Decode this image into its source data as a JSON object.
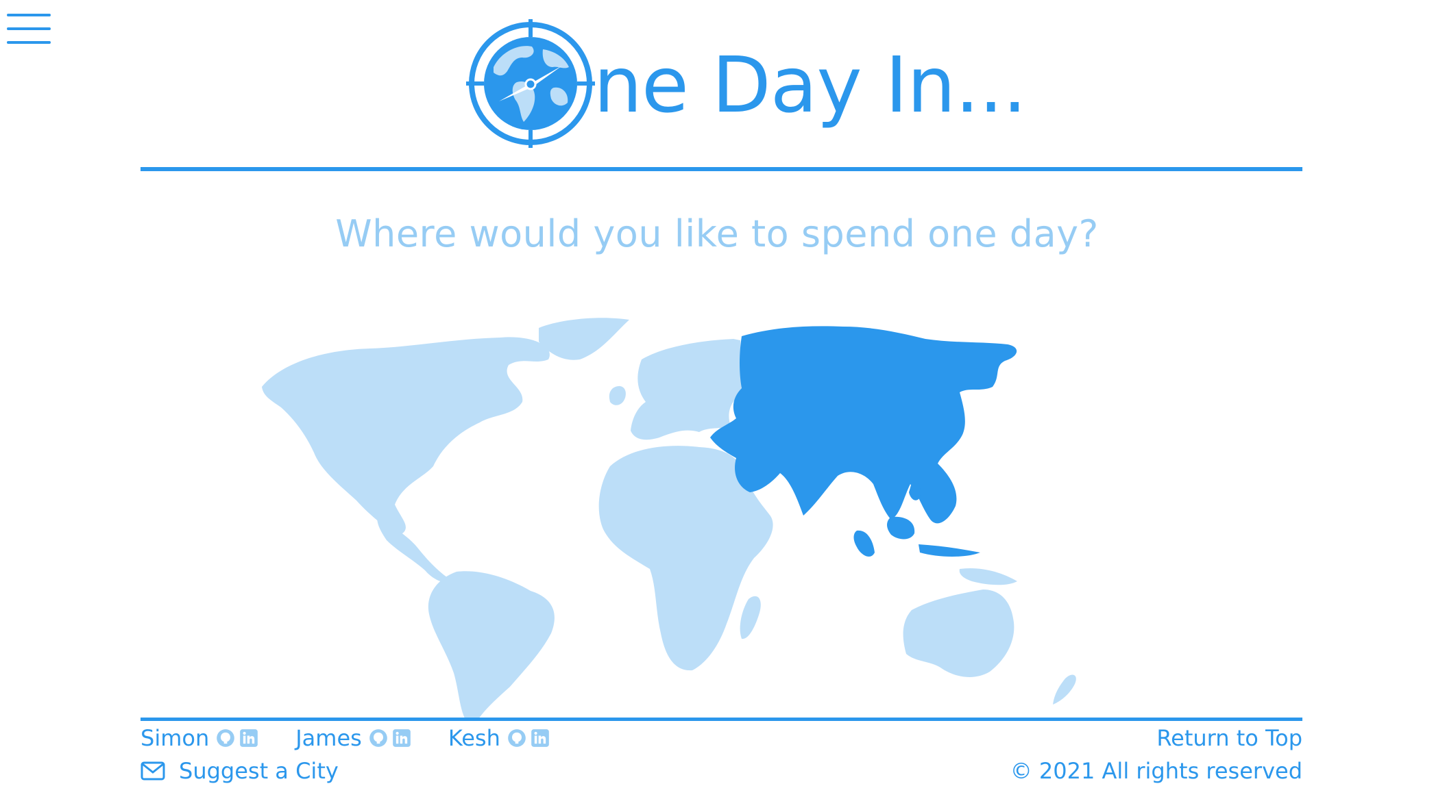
{
  "header": {
    "menu_icon": "hamburger-menu-icon",
    "logo_icon": "globe-compass-icon",
    "title": "ne Day In..."
  },
  "main": {
    "question": "Where would you like to spend one day?",
    "map": {
      "highlighted_region": "Asia",
      "regions": [
        "North America",
        "South America",
        "Europe",
        "Africa",
        "Asia",
        "Oceania"
      ],
      "colors": {
        "highlight": "#2b97ec",
        "default": "#bcdef8"
      }
    }
  },
  "footer": {
    "authors": [
      {
        "name": "Simon",
        "github_icon": "github-icon",
        "linkedin_icon": "linkedin-icon"
      },
      {
        "name": "James",
        "github_icon": "github-icon",
        "linkedin_icon": "linkedin-icon"
      },
      {
        "name": "Kesh",
        "github_icon": "github-icon",
        "linkedin_icon": "linkedin-icon"
      }
    ],
    "suggest_label": "Suggest a City",
    "suggest_icon": "envelope-icon",
    "return_label": "Return to Top",
    "copyright": "© 2021 All rights reserved"
  },
  "colors": {
    "accent": "#2b97ec",
    "light_accent": "#96ccf4",
    "map_light": "#bcdef8"
  }
}
